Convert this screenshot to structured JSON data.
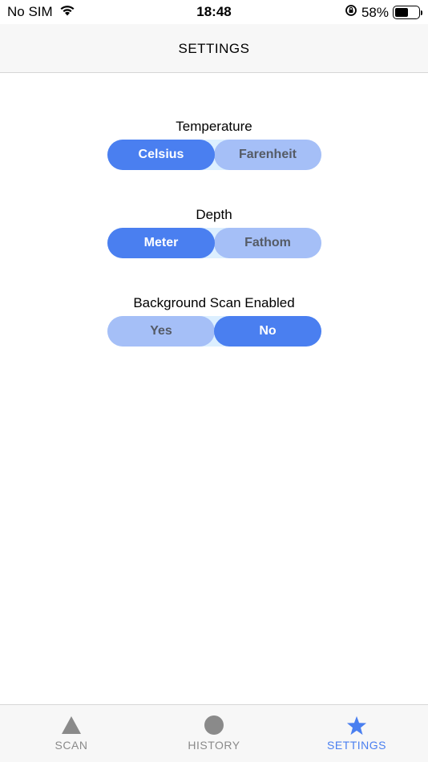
{
  "status_bar": {
    "carrier": "No SIM",
    "time": "18:48",
    "battery_percent": "58%",
    "battery_level": 0.58
  },
  "header": {
    "title": "SETTINGS"
  },
  "settings": [
    {
      "label": "Temperature",
      "options": [
        "Celsius",
        "Farenheit"
      ],
      "selected": 0
    },
    {
      "label": "Depth",
      "options": [
        "Meter",
        "Fathom"
      ],
      "selected": 0
    },
    {
      "label": "Background Scan Enabled",
      "options": [
        "Yes",
        "No"
      ],
      "selected": 1
    }
  ],
  "tabs": [
    {
      "label": "SCAN",
      "icon": "triangle-icon"
    },
    {
      "label": "HISTORY",
      "icon": "circle-icon"
    },
    {
      "label": "SETTINGS",
      "icon": "star-icon"
    }
  ],
  "colors": {
    "accent": "#4a7ff0",
    "inactive_segment": "#a5bff7",
    "tab_inactive": "#8a8a8a"
  }
}
